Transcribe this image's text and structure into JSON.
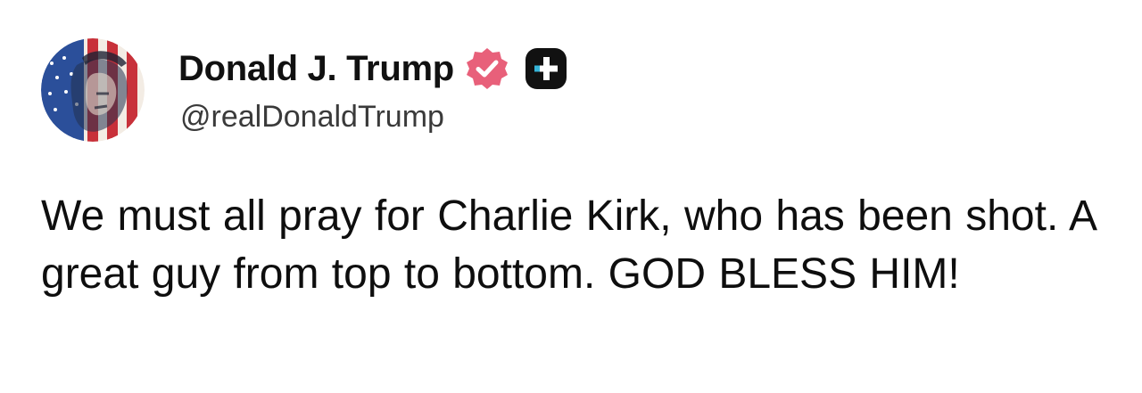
{
  "author": {
    "display_name": "Donald J. Trump",
    "handle": "@realDonaldTrump",
    "avatar_icon": "avatar-flag-portrait",
    "verified_icon": "verified-badge-icon",
    "verified_color": "#e8607a",
    "plus_icon": "plus-badge-icon",
    "plus_color": "#111111"
  },
  "post": {
    "text": "We must all pray for Charlie Kirk, who has been shot. A great guy from top to bottom. GOD BLESS HIM!"
  }
}
